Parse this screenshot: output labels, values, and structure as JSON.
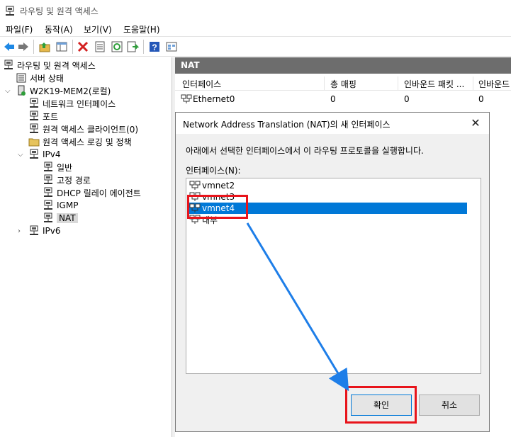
{
  "window": {
    "title": "라우팅 및 원격 액세스"
  },
  "menu": [
    "파일(F)",
    "동작(A)",
    "보기(V)",
    "도움말(H)"
  ],
  "toolbar_icons": [
    "back-icon",
    "forward-icon",
    "up-folder-icon",
    "show-hide-tree-icon",
    "delete-icon",
    "properties-icon",
    "refresh-icon",
    "export-icon",
    "help-icon",
    "view-icon"
  ],
  "tree": {
    "root": "라우팅 및 원격 액세스",
    "server_status": "서버 상태",
    "server": "W2K19-MEM2(로컬)",
    "network_interfaces": "네트워크 인터페이스",
    "ports": "포트",
    "remote_clients": "원격 액세스 클라이언트(0)",
    "remote_logging": "원격 액세스 로깅 및 정책",
    "ipv4": "IPv4",
    "general": "일반",
    "static_routes": "고정 경로",
    "dhcp_relay": "DHCP 릴레이 에이전트",
    "igmp": "IGMP",
    "nat": "NAT",
    "ipv6": "IPv6"
  },
  "right_pane": {
    "header": "NAT",
    "columns": [
      "인터페이스",
      "총 매핑",
      "인바운드 패킷 ...",
      "인바운드"
    ],
    "rows": [
      {
        "interface": "Ethernet0",
        "total": "0",
        "inbound_packets": "0",
        "inbound": "0"
      }
    ]
  },
  "dialog": {
    "title": "Network Address Translation (NAT)의 새 인터페이스",
    "description": "아래에서 선택한 인터페이스에서 이 라우팅 프로토콜을 실행합니다.",
    "list_label": "인터페이스(N):",
    "interfaces": [
      "vmnet2",
      "vmnet3",
      "vmnet4",
      "내부"
    ],
    "selected_index": 2,
    "ok": "확인",
    "cancel": "취소"
  },
  "colors": {
    "selection": "#0078d7",
    "header_bg": "#6d6d6d",
    "annotation": "#e8141b",
    "arrow": "#1e7ee8"
  }
}
